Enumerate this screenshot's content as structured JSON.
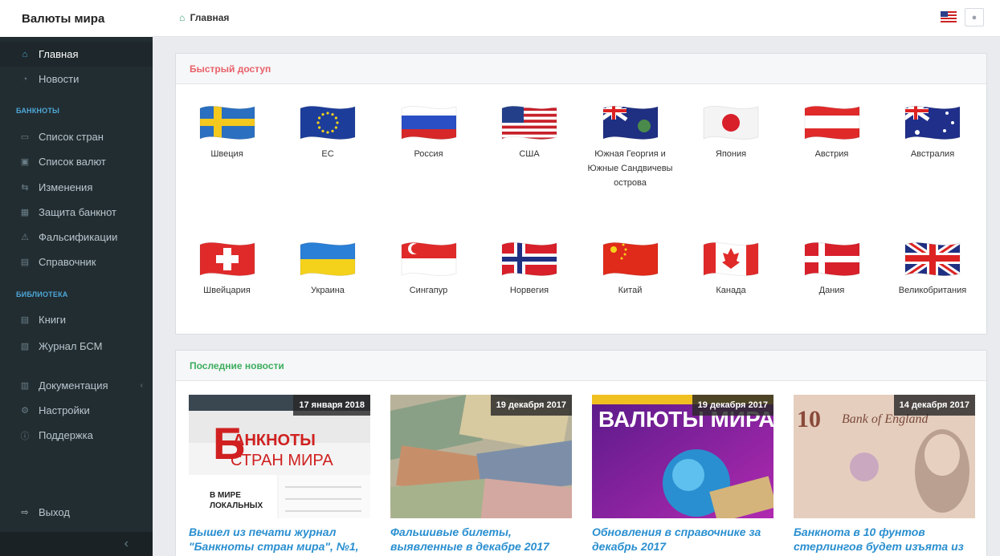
{
  "app": {
    "title": "Валюты мира"
  },
  "breadcrumb": {
    "label": "Главная"
  },
  "sidebar": {
    "nav": [
      {
        "label": "Главная",
        "icon": "home-icon",
        "glyph": "⌂"
      },
      {
        "label": "Новости",
        "icon": "rss-icon",
        "glyph": "◔"
      }
    ],
    "banknotes_header": "БАНКНОТЫ",
    "banknotes": [
      {
        "label": "Список стран",
        "icon": "flag-icon",
        "glyph": "▭"
      },
      {
        "label": "Список валют",
        "icon": "money-icon",
        "glyph": "▣"
      },
      {
        "label": "Изменения",
        "icon": "exchange-icon",
        "glyph": "⇆"
      },
      {
        "label": "Защита банкнот",
        "icon": "grid-icon",
        "glyph": "▦"
      },
      {
        "label": "Фальсификации",
        "icon": "warning-icon",
        "glyph": "⚠"
      },
      {
        "label": "Справочник",
        "icon": "file-icon",
        "glyph": "▤"
      }
    ],
    "library_header": "БИБЛИОТЕКА",
    "library": [
      {
        "label": "Книги",
        "icon": "book-icon",
        "glyph": "▤"
      },
      {
        "label": "Журнал БСМ",
        "icon": "pdf-icon",
        "glyph": "▧"
      }
    ],
    "extra": [
      {
        "label": "Документация",
        "icon": "docs-icon",
        "glyph": "▥"
      },
      {
        "label": "Настройки",
        "icon": "gear-icon",
        "glyph": "⚙"
      },
      {
        "label": "Поддержка",
        "icon": "info-icon",
        "glyph": "ⓘ"
      }
    ],
    "logout": {
      "label": "Выход",
      "icon": "logout-icon",
      "glyph": "⇨"
    }
  },
  "quick_access": {
    "title": "Быстрый доступ",
    "countries": [
      {
        "name": "Швеция",
        "flag": "sweden"
      },
      {
        "name": "ЕС",
        "flag": "eu"
      },
      {
        "name": "Россия",
        "flag": "russia"
      },
      {
        "name": "США",
        "flag": "usa"
      },
      {
        "name": "Южная Георгия и Южные Сандвичевы острова",
        "flag": "sgssi"
      },
      {
        "name": "Япония",
        "flag": "japan"
      },
      {
        "name": "Австрия",
        "flag": "austria"
      },
      {
        "name": "Австралия",
        "flag": "australia"
      },
      {
        "name": "Швейцария",
        "flag": "switzerland"
      },
      {
        "name": "Украина",
        "flag": "ukraine"
      },
      {
        "name": "Сингапур",
        "flag": "singapore"
      },
      {
        "name": "Норвегия",
        "flag": "norway"
      },
      {
        "name": "Китай",
        "flag": "china"
      },
      {
        "name": "Канада",
        "flag": "canada"
      },
      {
        "name": "Дания",
        "flag": "denmark"
      },
      {
        "name": "Великобритания",
        "flag": "uk"
      }
    ]
  },
  "news": {
    "title": "Последние новости",
    "items": [
      {
        "date": "17 января 2018",
        "title": "Вышел из печати журнал \"Банкноты стран мира\", №1,",
        "img_text": "БАНКНОТЫ СТРАН МИРА"
      },
      {
        "date": "19 декабря 2017",
        "title": "Фальшивые билеты, выявленные в декабре 2017",
        "img_text": ""
      },
      {
        "date": "19 декабря 2017",
        "title": "Обновления в справочнике за декабрь 2017",
        "img_text": "ВАЛЮТЫ МИРА:"
      },
      {
        "date": "14 декабря 2017",
        "title": "Банкнота в 10 фунтов стерлингов будет изъята из",
        "img_text": ""
      }
    ]
  },
  "colors": {
    "sidebar_bg": "#222d32",
    "accent_blue": "#2a8fd0",
    "quick_red": "#e8616a",
    "news_green": "#3cae5e"
  }
}
